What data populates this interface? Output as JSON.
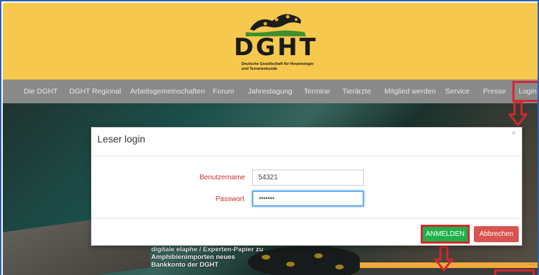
{
  "header": {
    "logo_text": "DGHT",
    "logo_subtitle": "Deutsche Gesellschaft für Herpetologie und Terrarienkunde",
    "background": "#f6c84d"
  },
  "nav": {
    "items": [
      {
        "label": "Die DGHT"
      },
      {
        "label": "DGHT Regional"
      },
      {
        "label": "Arbeitsgemeinschaften"
      },
      {
        "label": "Forum"
      },
      {
        "label": "Jahrestagung"
      },
      {
        "label": "Termine"
      },
      {
        "label": "Tierärzte"
      },
      {
        "label": "Mitglied werden"
      },
      {
        "label": "Service"
      },
      {
        "label": "Presse"
      },
      {
        "label": "Login"
      }
    ],
    "highlight_color": "#d8262f"
  },
  "modal": {
    "title": "Leser login",
    "close_icon": "×",
    "username_label": "Benutzername",
    "username_value": "54321",
    "password_label": "Passwort",
    "password_value": "•••••••",
    "submit_label": "ANMELDEN",
    "cancel_label": "Abbrechen"
  },
  "hero": {
    "news_text": "digitale elaphe / Experten-Papier zu Amphibienimporten neues Bankkonto der DGHT"
  },
  "colors": {
    "submit": "#20b14a",
    "cancel": "#d9534f",
    "label_red": "#c9302c",
    "annotation_red": "#d8262f"
  }
}
